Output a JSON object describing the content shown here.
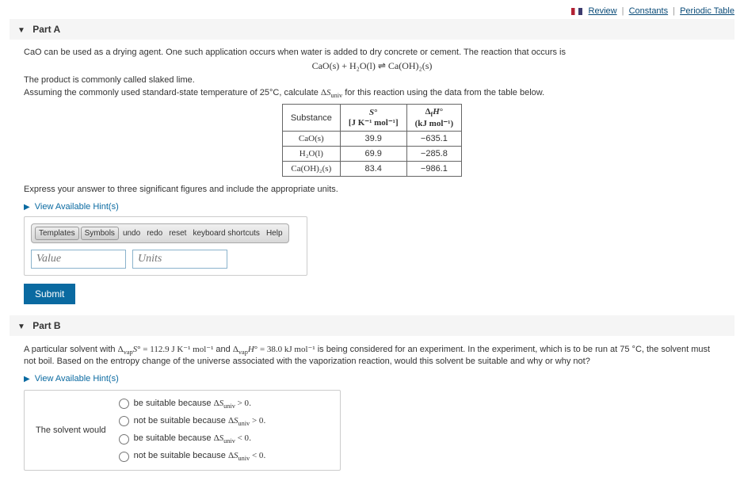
{
  "header": {
    "review": "Review",
    "constants": "Constants",
    "periodic": "Periodic Table"
  },
  "partA": {
    "title": "Part A",
    "intro": "CaO can be used as a drying agent. One such application occurs when water is added to dry concrete or cement. The reaction that occurs is",
    "equation": "CaO(s) + H₂O(l) ⇌ Ca(OH)₂(s)",
    "product_line": "The product is commonly called slaked lime.",
    "calc_line_prefix": "Assuming the commonly used standard-state temperature of 25°C, calculate ",
    "calc_line_var": "ΔSuniv",
    "calc_line_suffix": " for this reaction using the data from the table below.",
    "table": {
      "col1": "Substance",
      "col2_top": "S°",
      "col2_units": "[J K⁻¹ mol⁻¹]",
      "col3_top": "ΔfH°",
      "col3_units": "(kJ mol⁻¹)",
      "rows": [
        {
          "sub": "CaO(s)",
          "s": "39.9",
          "h": "−635.1"
        },
        {
          "sub": "H₂O(l)",
          "s": "69.9",
          "h": "−285.8"
        },
        {
          "sub": "Ca(OH)₂(s)",
          "s": "83.4",
          "h": "−986.1"
        }
      ]
    },
    "instruct": "Express your answer to three significant figures and include the appropriate units.",
    "hint_link": "View Available Hint(s)",
    "toolbar": {
      "templates": "Templates",
      "symbols": "Symbols",
      "undo": "undo",
      "redo": "redo",
      "reset": "reset",
      "keyboard": "keyboard shortcuts",
      "help": "Help"
    },
    "value_placeholder": "Value",
    "units_placeholder": "Units",
    "submit": "Submit"
  },
  "partB": {
    "title": "Part B",
    "text_prefix": "A particular solvent with ",
    "vap_s_label": "ΔvapS° = 112.9 J K⁻¹ mol⁻¹",
    "and": " and ",
    "vap_h_label": "ΔvapH° = 38.0 kJ mol⁻¹",
    "text_suffix": " is being considered for an experiment. In the experiment, which is to be run at 75 °C, the solvent must not boil. Based on the entropy change of the universe associated with the vaporization reaction, would this solvent be suitable and why or why not?",
    "hint_link": "View Available Hint(s)",
    "prompt": "The solvent would",
    "options": {
      "o1_a": "be suitable because ",
      "o1_b": "ΔSuniv > 0",
      "o2_a": "not be suitable because ",
      "o2_b": "ΔSuniv > 0",
      "o3_a": "be suitable because ",
      "o3_b": "ΔSuniv < 0",
      "o4_a": "not be suitable because ",
      "o4_b": "ΔSuniv < 0"
    }
  }
}
